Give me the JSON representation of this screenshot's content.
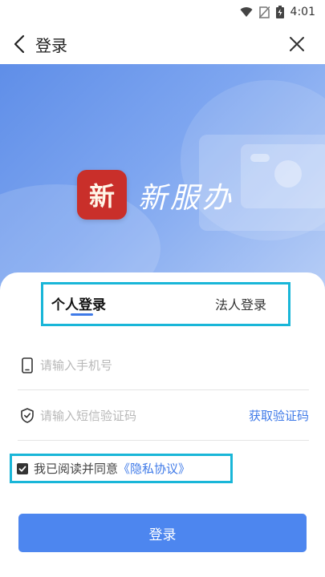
{
  "status_bar": {
    "time": "4:01"
  },
  "header": {
    "title": "登录"
  },
  "banner": {
    "app_name": "新服办",
    "logo_text": "新"
  },
  "tabs": [
    {
      "label": "个人登录",
      "active": true
    },
    {
      "label": "法人登录",
      "active": false
    }
  ],
  "form": {
    "phone_placeholder": "请输入手机号",
    "code_placeholder": "请输入短信验证码",
    "get_code_label": "获取验证码"
  },
  "agreement": {
    "checked": true,
    "text": "我已阅读并同意",
    "link_text": "《隐私协议》"
  },
  "login_button": {
    "label": "登录"
  },
  "colors": {
    "accent": "#4d86ef",
    "link": "#3f7ae8",
    "highlight_box": "#19b6d8",
    "logo_bg": "#c92f2a"
  }
}
